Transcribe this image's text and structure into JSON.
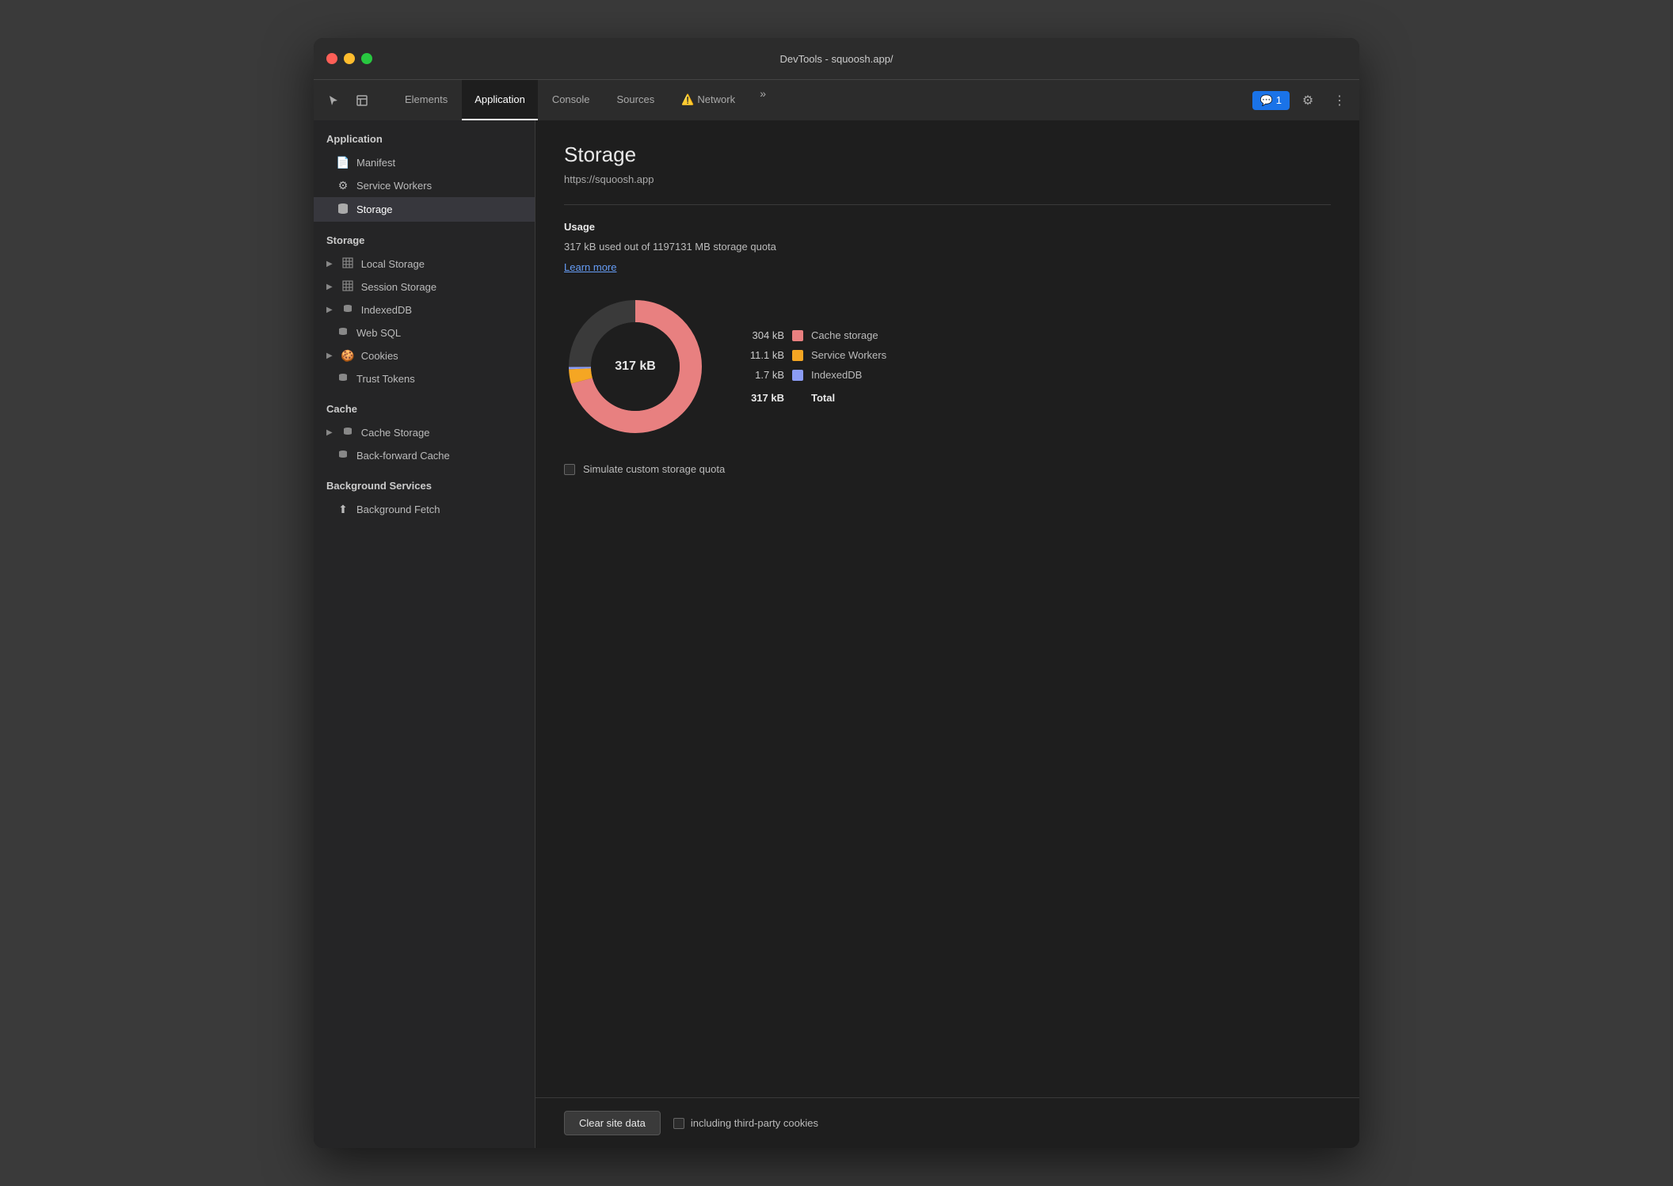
{
  "titlebar": {
    "title": "DevTools - squoosh.app/"
  },
  "tabs": [
    {
      "id": "elements",
      "label": "Elements",
      "active": false
    },
    {
      "id": "application",
      "label": "Application",
      "active": true
    },
    {
      "id": "console",
      "label": "Console",
      "active": false
    },
    {
      "id": "sources",
      "label": "Sources",
      "active": false
    },
    {
      "id": "network",
      "label": "Network",
      "active": false,
      "warning": true
    }
  ],
  "tabbar": {
    "more_label": "»",
    "notification_count": "1",
    "notification_icon": "💬"
  },
  "sidebar": {
    "section_application": "Application",
    "section_storage": "Storage",
    "section_cache": "Cache",
    "section_background": "Background Services",
    "items_application": [
      {
        "id": "manifest",
        "label": "Manifest",
        "icon": "📄"
      },
      {
        "id": "service-workers",
        "label": "Service Workers",
        "icon": "⚙️"
      },
      {
        "id": "storage",
        "label": "Storage",
        "icon": "🗄️",
        "active": true
      }
    ],
    "items_storage": [
      {
        "id": "local-storage",
        "label": "Local Storage",
        "icon": "⊞",
        "arrow": true
      },
      {
        "id": "session-storage",
        "label": "Session Storage",
        "icon": "⊞",
        "arrow": true
      },
      {
        "id": "indexeddb",
        "label": "IndexedDB",
        "icon": "🗄️",
        "arrow": true
      },
      {
        "id": "web-sql",
        "label": "Web SQL",
        "icon": "🗄️",
        "arrow": false
      },
      {
        "id": "cookies",
        "label": "Cookies",
        "icon": "🍪",
        "arrow": true
      },
      {
        "id": "trust-tokens",
        "label": "Trust Tokens",
        "icon": "🗄️",
        "arrow": false
      }
    ],
    "items_cache": [
      {
        "id": "cache-storage",
        "label": "Cache Storage",
        "icon": "🗄️",
        "arrow": true
      },
      {
        "id": "back-forward-cache",
        "label": "Back-forward Cache",
        "icon": "🗄️",
        "arrow": false
      }
    ],
    "items_background": [
      {
        "id": "background-fetch",
        "label": "Background Fetch",
        "icon": "⬆",
        "arrow": false
      }
    ]
  },
  "content": {
    "title": "Storage",
    "url": "https://squoosh.app",
    "usage_label": "Usage",
    "usage_text": "317 kB used out of 1197131 MB storage quota",
    "learn_more": "Learn more",
    "donut_center": "317 kB",
    "legend": [
      {
        "label": "Cache storage",
        "value": "304 kB",
        "color": "#e88080"
      },
      {
        "label": "Service Workers",
        "value": "11.1 kB",
        "color": "#f5a623"
      },
      {
        "label": "IndexedDB",
        "value": "1.7 kB",
        "color": "#8b9cf5"
      }
    ],
    "total_label": "Total",
    "total_value": "317 kB",
    "simulate_label": "Simulate custom storage quota",
    "clear_btn": "Clear site data",
    "third_party_label": "including third-party cookies"
  },
  "colors": {
    "cache_storage": "#e88080",
    "service_workers": "#f5a623",
    "indexeddb": "#8b9cf5",
    "donut_bg": "#3a3a3a"
  }
}
